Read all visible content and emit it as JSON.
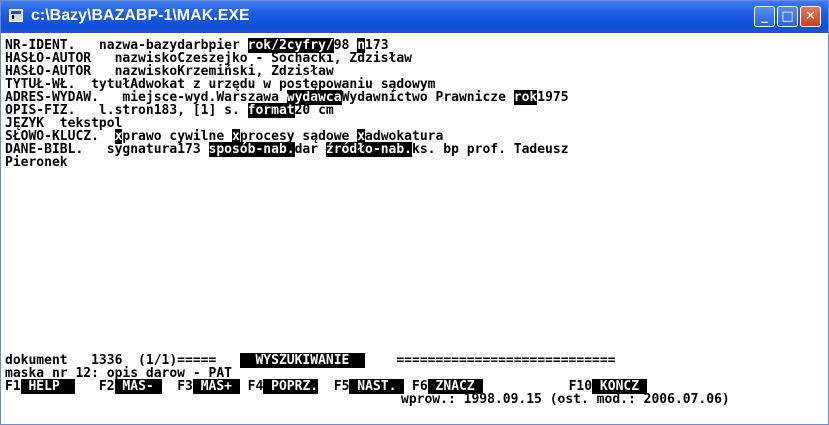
{
  "window": {
    "title": "c:\\Bazy\\BAZABP-1\\MAK.EXE"
  },
  "record": [
    {
      "parts": [
        {
          "t": "NR-IDENT.   nazwa-bazy",
          "rev": false
        },
        {
          "t": "darbpier ",
          "rev": false
        },
        {
          "t": "rok/2cyfry/",
          "rev": true
        },
        {
          "t": "98 ",
          "rev": false
        },
        {
          "t": "n",
          "rev": true
        },
        {
          "t": "173",
          "rev": false
        }
      ]
    },
    {
      "parts": [
        {
          "t": "HASŁO-AUTOR   nazwisko",
          "rev": false
        },
        {
          "t": "Czeszejko - Sochacki, Zdzisław",
          "rev": false
        }
      ]
    },
    {
      "parts": [
        {
          "t": "HASŁO-AUTOR   nazwisko",
          "rev": false
        },
        {
          "t": "Krzemiński, Zdzisław",
          "rev": false
        }
      ]
    },
    {
      "parts": [
        {
          "t": "TYTUŁ-WŁ.  tytuł",
          "rev": false
        },
        {
          "t": "Adwokat z urzędu w postępowaniu sądowym",
          "rev": false
        }
      ]
    },
    {
      "parts": [
        {
          "t": "ADRES-WYDAW.   miejsce-wyd.",
          "rev": false
        },
        {
          "t": "Warszawa ",
          "rev": false
        },
        {
          "t": "wydawca",
          "rev": true
        },
        {
          "t": "Wydawnictwo Prawnicze ",
          "rev": false
        },
        {
          "t": "rok",
          "rev": true
        },
        {
          "t": "1975",
          "rev": false
        }
      ]
    },
    {
      "parts": [
        {
          "t": "OPIS-FIZ.   l.stron",
          "rev": false
        },
        {
          "t": "183, [1] s. ",
          "rev": false
        },
        {
          "t": "format",
          "rev": true
        },
        {
          "t": "20 cm",
          "rev": false
        }
      ]
    },
    {
      "parts": [
        {
          "t": "JĘZYK  tekst",
          "rev": false
        },
        {
          "t": "pol",
          "rev": false
        }
      ]
    },
    {
      "parts": [
        {
          "t": "SŁOWO-KLUCZ.  ",
          "rev": false
        },
        {
          "t": "x",
          "rev": true
        },
        {
          "t": "prawo cywilne ",
          "rev": false
        },
        {
          "t": "x",
          "rev": true
        },
        {
          "t": "procesy sądowe ",
          "rev": false
        },
        {
          "t": "x",
          "rev": true
        },
        {
          "t": "adwokatura",
          "rev": false
        }
      ]
    },
    {
      "parts": [
        {
          "t": "DANE-BIBL.   sygnatura",
          "rev": false
        },
        {
          "t": "173 ",
          "rev": false
        },
        {
          "t": "sposób-nab.",
          "rev": true
        },
        {
          "t": "dar ",
          "rev": false
        },
        {
          "t": "źródło-nab.",
          "rev": true
        },
        {
          "t": "ks. bp prof. Tadeusz",
          "rev": false
        }
      ]
    },
    {
      "parts": [
        {
          "t": "Pieronek",
          "rev": false
        }
      ]
    }
  ],
  "status": {
    "doc_line": "dokument   1336  (1/1)=====   ",
    "mode": "  WYSZUKIWANIE  ",
    "doc_line_tail": "    ============================",
    "mask_line": "maska nr 12: opis darow - PAT",
    "wprow_line": "wprow.: 1998.09.15 (ost. mod.: 2006.07.06)"
  },
  "fkeys": [
    {
      "key": "F1",
      "label": " HELP  "
    },
    {
      "key": "   F2",
      "label": " MAS- "
    },
    {
      "key": "  F3",
      "label": " MAS+ "
    },
    {
      "key": " F4",
      "label": " POPRZ."
    },
    {
      "key": "  F5",
      "label": " NAST. "
    },
    {
      "key": " F6",
      "label": " ZNACZ "
    },
    {
      "key": "           F10",
      "label": " KOŃCZ "
    }
  ]
}
